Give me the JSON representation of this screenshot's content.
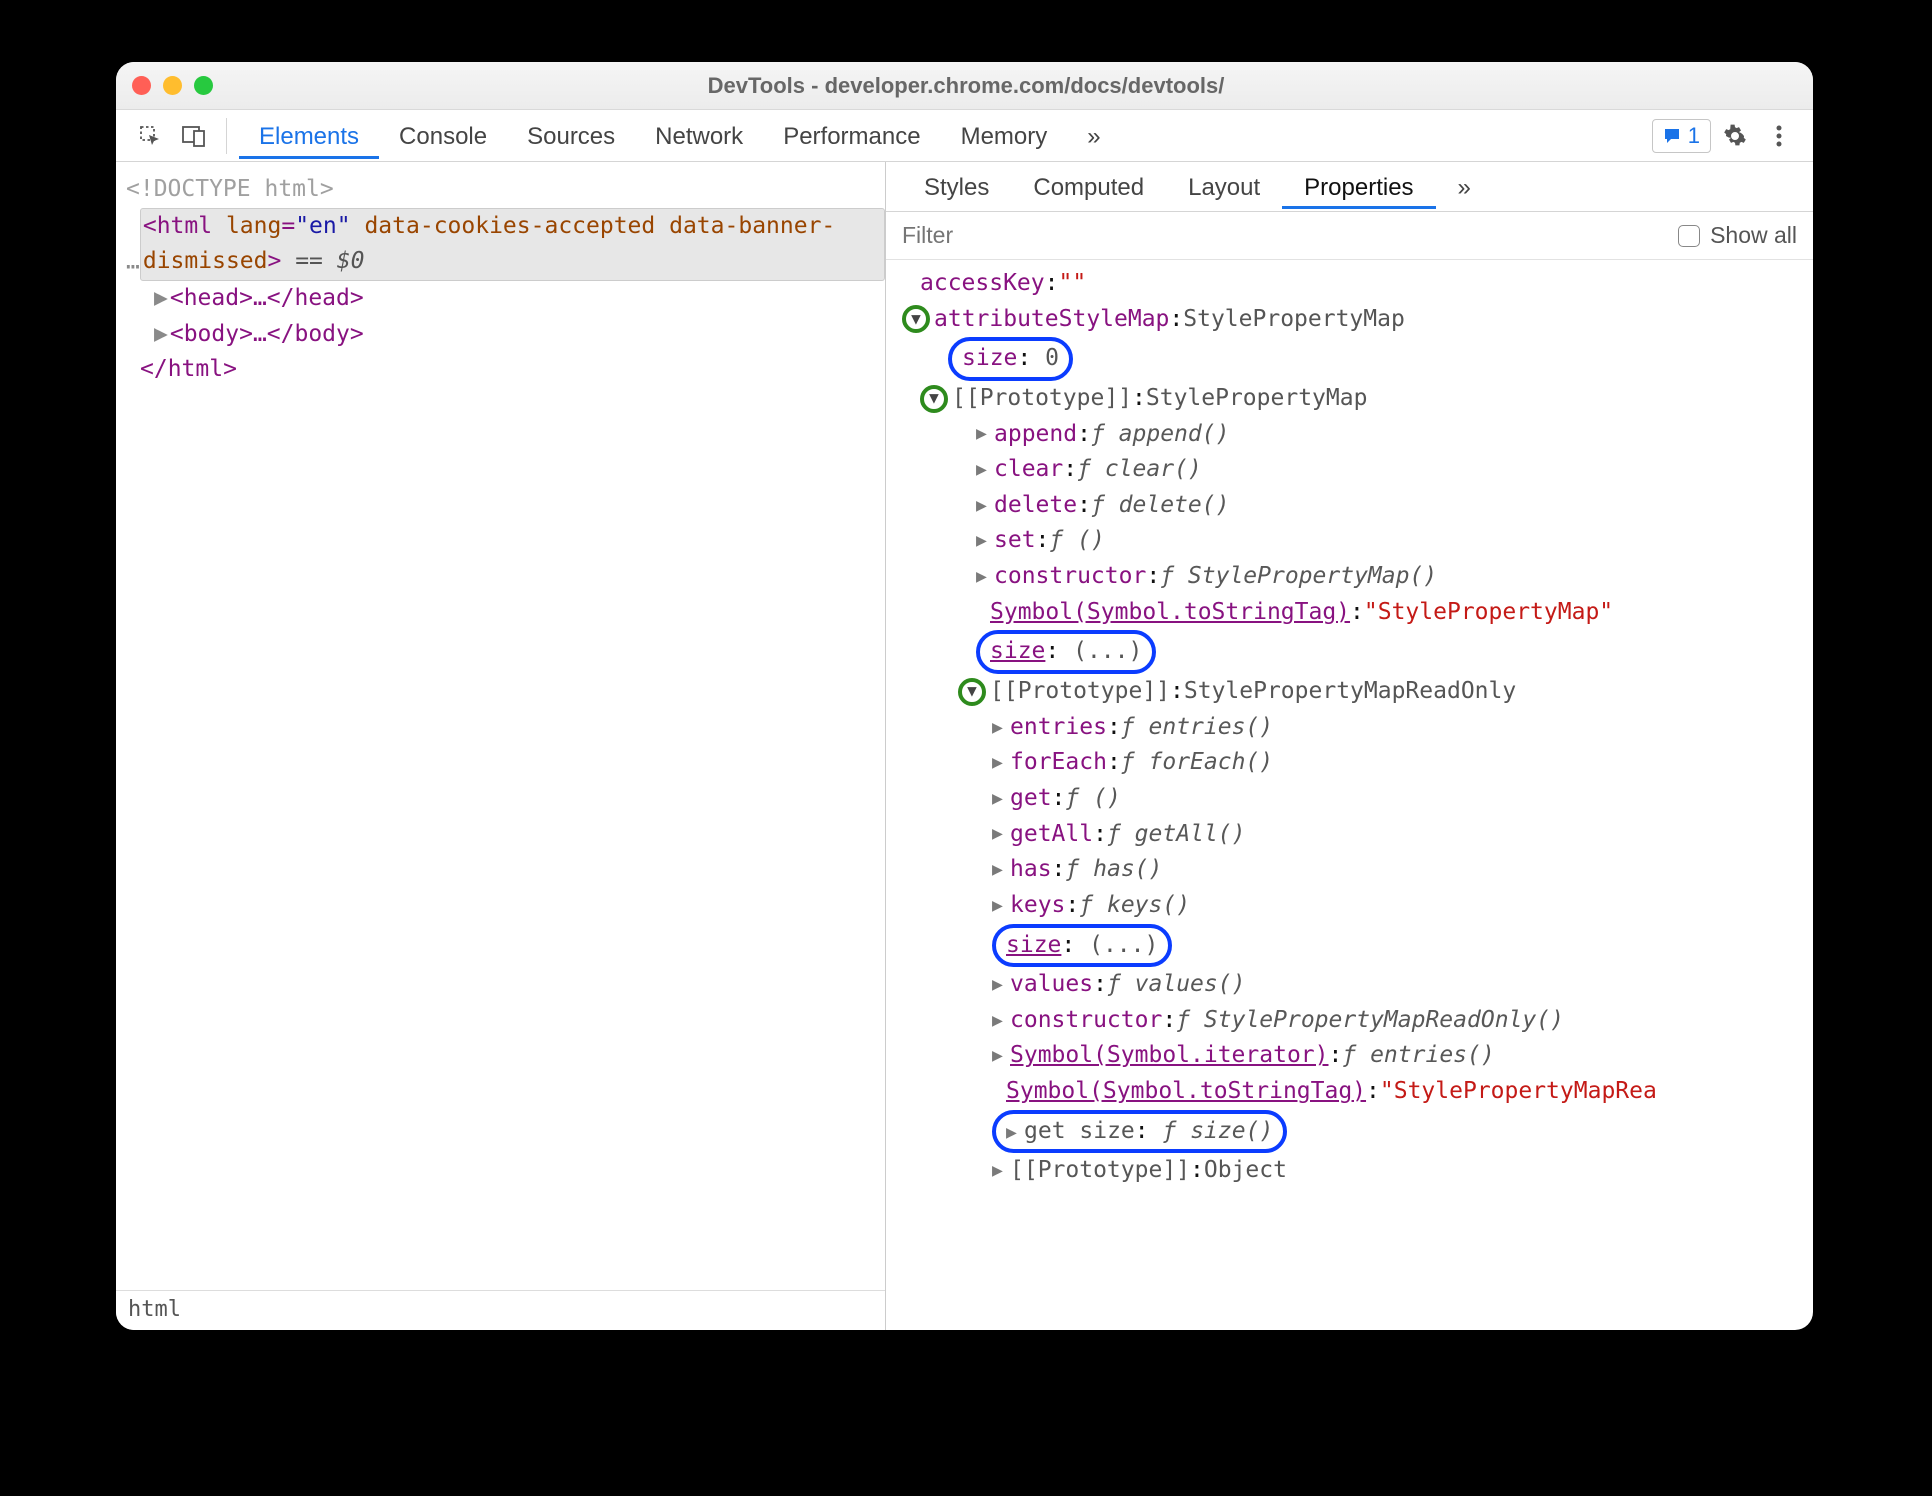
{
  "window": {
    "title": "DevTools - developer.chrome.com/docs/devtools/"
  },
  "main_tabs": {
    "items": [
      "Elements",
      "Console",
      "Sources",
      "Network",
      "Performance",
      "Memory"
    ],
    "active": "Elements",
    "more_glyph": "»"
  },
  "issues": {
    "count": "1"
  },
  "dom": {
    "doctype": "<!DOCTYPE html>",
    "html_open_a": "<html ",
    "lang_attr": "lang",
    "lang_val": "\"en\"",
    "attr_cookies": "data-cookies-accepted",
    "attr_banner": "data-banner-dismissed",
    "suffix": " == $0",
    "head": "<head>…</head>",
    "body": "<body>…</body>",
    "html_close": "</html>",
    "ellipsis": "…"
  },
  "crumb": "html",
  "side_tabs": {
    "items": [
      "Styles",
      "Computed",
      "Layout",
      "Properties"
    ],
    "active": "Properties",
    "more_glyph": "»"
  },
  "filter": {
    "placeholder": "Filter",
    "showall_label": "Show all"
  },
  "props": {
    "accessKey": {
      "k": "accessKey",
      "v": "\"\""
    },
    "attributeStyleMap": {
      "k": "attributeStyleMap",
      "v": "StylePropertyMap"
    },
    "size0": {
      "k": "size",
      "v": "0"
    },
    "proto1": {
      "k": "[[Prototype]]",
      "v": "StylePropertyMap"
    },
    "append": {
      "k": "append",
      "fn": "append()"
    },
    "clear": {
      "k": "clear",
      "fn": "clear()"
    },
    "delete": {
      "k": "delete",
      "fn": "delete()"
    },
    "set": {
      "k": "set",
      "fn": "()"
    },
    "ctor1": {
      "k": "constructor",
      "fn": "StylePropertyMap()"
    },
    "symTag1": {
      "k": "Symbol(Symbol.toStringTag)",
      "v": "\"StylePropertyMap\""
    },
    "sizeDots1": {
      "k": "size",
      "v": "(...)"
    },
    "proto2": {
      "k": "[[Prototype]]",
      "v": "StylePropertyMapReadOnly"
    },
    "entries": {
      "k": "entries",
      "fn": "entries()"
    },
    "forEach": {
      "k": "forEach",
      "fn": "forEach()"
    },
    "get": {
      "k": "get",
      "fn": "()"
    },
    "getAll": {
      "k": "getAll",
      "fn": "getAll()"
    },
    "has": {
      "k": "has",
      "fn": "has()"
    },
    "keys": {
      "k": "keys",
      "fn": "keys()"
    },
    "sizeDots2": {
      "k": "size",
      "v": "(...)"
    },
    "values": {
      "k": "values",
      "fn": "values()"
    },
    "ctor2": {
      "k": "constructor",
      "fn": "StylePropertyMapReadOnly()"
    },
    "symIter": {
      "k": "Symbol(Symbol.iterator)",
      "fn": "entries()"
    },
    "symTag2": {
      "k": "Symbol(Symbol.toStringTag)",
      "v": "\"StylePropertyMapRea"
    },
    "getSize": {
      "k": "get size",
      "fn": "size()"
    },
    "proto3": {
      "k": "[[Prototype]]",
      "v": "Object"
    },
    "fChar": "ƒ"
  }
}
